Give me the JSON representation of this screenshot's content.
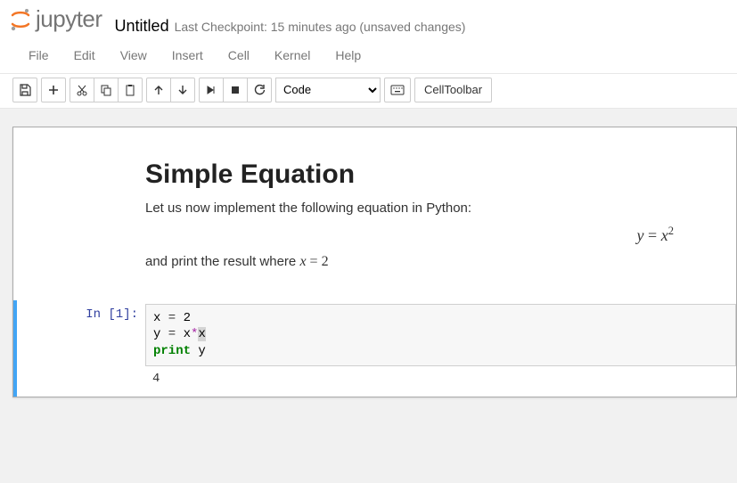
{
  "header": {
    "logo_text": "jupyter",
    "title": "Untitled",
    "checkpoint": "Last Checkpoint: 15 minutes ago (unsaved changes)"
  },
  "menu": {
    "file": "File",
    "edit": "Edit",
    "view": "View",
    "insert": "Insert",
    "cell": "Cell",
    "kernel": "Kernel",
    "help": "Help"
  },
  "toolbar": {
    "cell_type_selected": "Code",
    "cell_toolbar_label": "CellToolbar"
  },
  "markdown": {
    "heading": "Simple Equation",
    "line1": "Let us now implement the following equation in Python:",
    "equation_y": "y",
    "equation_eq": " = ",
    "equation_x": "x",
    "equation_sup": "2",
    "line2_pre": "and print the result where ",
    "line2_var": "x",
    "line2_eq": " = ",
    "line2_val": "2"
  },
  "code_cell": {
    "prompt": "In [1]:",
    "l1_var": "x",
    "l1_eq": " = ",
    "l1_val": "2",
    "l2_var": "y",
    "l2_eq": " = ",
    "l2_rhs1": "x",
    "l2_op": "*",
    "l2_rhs2": "x",
    "l3_kw": "print",
    "l3_sp": " ",
    "l3_var": "y",
    "output": "4"
  }
}
